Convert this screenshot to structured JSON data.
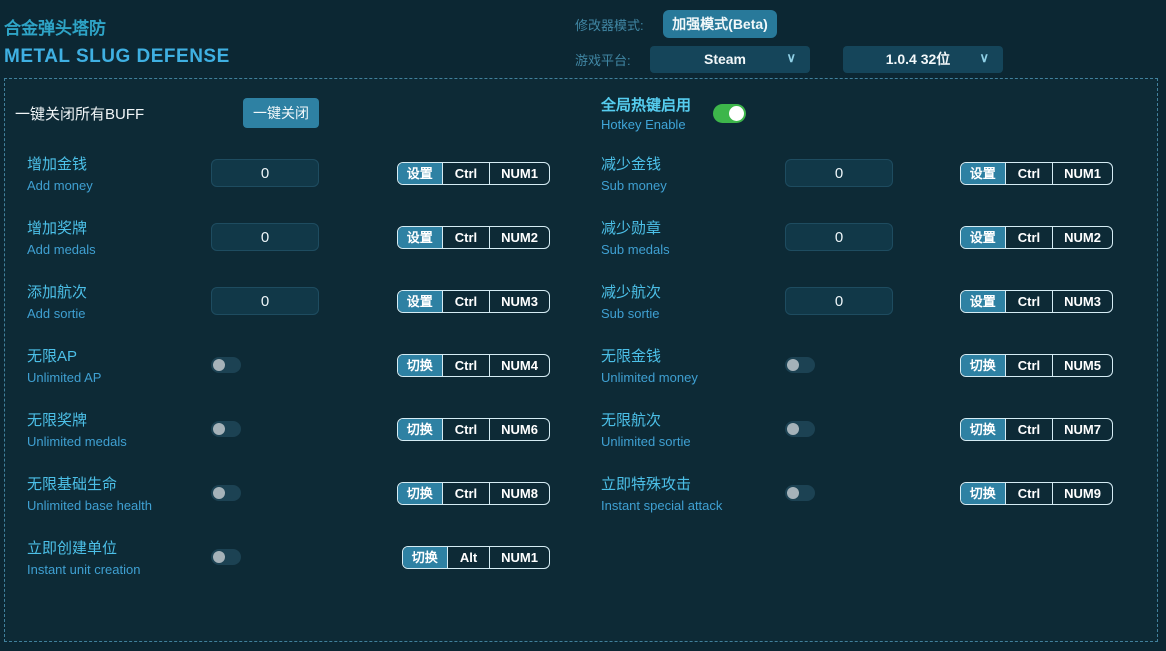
{
  "header": {
    "title_cn": "合金弹头塔防",
    "title_en": "METAL SLUG DEFENSE",
    "mode_label": "修改器模式:",
    "mode_button": "加强模式(Beta)",
    "platform_label": "游戏平台:",
    "platform_select": "Steam",
    "version_select": "1.0.4 32位"
  },
  "icons": {
    "chevron_down": "∨"
  },
  "master": {
    "buff_label": "一键关闭所有BUFF",
    "buff_button": "一键关闭",
    "hotkey_label_cn": "全局热键启用",
    "hotkey_label_en": "Hotkey Enable",
    "hotkey_enabled": true
  },
  "rows": {
    "left": [
      {
        "cn": "增加金钱",
        "en": "Add money",
        "control": "input",
        "value": "0",
        "action": "设置",
        "mod": "Ctrl",
        "key": "NUM1"
      },
      {
        "cn": "增加奖牌",
        "en": "Add medals",
        "control": "input",
        "value": "0",
        "action": "设置",
        "mod": "Ctrl",
        "key": "NUM2"
      },
      {
        "cn": "添加航次",
        "en": "Add sortie",
        "control": "input",
        "value": "0",
        "action": "设置",
        "mod": "Ctrl",
        "key": "NUM3"
      },
      {
        "cn": "无限AP",
        "en": "Unlimited AP",
        "control": "toggle",
        "state": false,
        "action": "切换",
        "mod": "Ctrl",
        "key": "NUM4"
      },
      {
        "cn": "无限奖牌",
        "en": "Unlimited medals",
        "control": "toggle",
        "state": false,
        "action": "切换",
        "mod": "Ctrl",
        "key": "NUM6"
      },
      {
        "cn": "无限基础生命",
        "en": "Unlimited base health",
        "control": "toggle",
        "state": false,
        "action": "切换",
        "mod": "Ctrl",
        "key": "NUM8"
      },
      {
        "cn": "立即创建单位",
        "en": "Instant unit creation",
        "control": "toggle",
        "state": false,
        "action": "切换",
        "mod": "Alt",
        "key": "NUM1"
      }
    ],
    "right": [
      {
        "cn": "减少金钱",
        "en": "Sub money",
        "control": "input",
        "value": "0",
        "action": "设置",
        "mod": "Ctrl",
        "key": "NUM1"
      },
      {
        "cn": "减少勋章",
        "en": "Sub medals",
        "control": "input",
        "value": "0",
        "action": "设置",
        "mod": "Ctrl",
        "key": "NUM2"
      },
      {
        "cn": "减少航次",
        "en": "Sub sortie",
        "control": "input",
        "value": "0",
        "action": "设置",
        "mod": "Ctrl",
        "key": "NUM3"
      },
      {
        "cn": "无限金钱",
        "en": "Unlimited money",
        "control": "toggle",
        "state": false,
        "action": "切换",
        "mod": "Ctrl",
        "key": "NUM5"
      },
      {
        "cn": "无限航次",
        "en": "Unlimited sortie",
        "control": "toggle",
        "state": false,
        "action": "切换",
        "mod": "Ctrl",
        "key": "NUM7"
      },
      {
        "cn": "立即特殊攻击",
        "en": "Instant special attack",
        "control": "toggle",
        "state": false,
        "action": "切换",
        "mod": "Ctrl",
        "key": "NUM9"
      }
    ]
  },
  "colors": {
    "background": "#0c2733",
    "panel_border": "#41809c",
    "accent_teal": "#2e81a3",
    "label_cyan": "#4cc0e8",
    "label_blue": "#3fa0d2",
    "toggle_on_green": "#3db64b",
    "title_cn_color": "#2ea4c6",
    "title_en_color": "#3fb0e2"
  }
}
